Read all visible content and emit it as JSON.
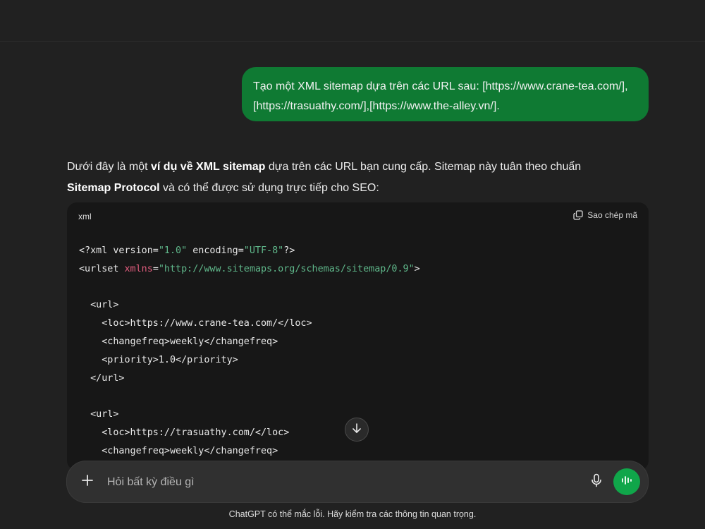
{
  "user_message": {
    "text": "Tạo một XML sitemap dựa trên các URL sau: [https://www.crane-tea.com/], [https://trasuathy.com/],[https://www.the-alley.vn/]."
  },
  "assistant_message": {
    "intro_part1": "Dưới đây là một ",
    "intro_bold1": "ví dụ về XML sitemap",
    "intro_part2": " dựa trên các URL bạn cung cấp. Sitemap này tuân theo chuẩn ",
    "intro_bold2": "Sitemap Protocol",
    "intro_part3": " và có thể được sử dụng trực tiếp cho SEO:"
  },
  "code_block": {
    "language": "xml",
    "copy_label": "Sao chép mã",
    "lines": [
      [
        {
          "t": "pi",
          "v": "<?xml version="
        },
        {
          "t": "str",
          "v": "\"1.0\""
        },
        {
          "t": "pi",
          "v": " encoding="
        },
        {
          "t": "str",
          "v": "\"UTF-8\""
        },
        {
          "t": "pi",
          "v": "?>"
        }
      ],
      [
        {
          "t": "tag",
          "v": "<urlset "
        },
        {
          "t": "attr",
          "v": "xmlns"
        },
        {
          "t": "tag",
          "v": "="
        },
        {
          "t": "str",
          "v": "\"http://www.sitemaps.org/schemas/sitemap/0.9\""
        },
        {
          "t": "tag",
          "v": ">"
        }
      ],
      [],
      [
        {
          "t": "tag",
          "v": "  <url>"
        }
      ],
      [
        {
          "t": "tag",
          "v": "    <loc>https://www.crane-tea.com/</loc>"
        }
      ],
      [
        {
          "t": "tag",
          "v": "    <changefreq>weekly</changefreq>"
        }
      ],
      [
        {
          "t": "tag",
          "v": "    <priority>1.0</priority>"
        }
      ],
      [
        {
          "t": "tag",
          "v": "  </url>"
        }
      ],
      [],
      [
        {
          "t": "tag",
          "v": "  <url>"
        }
      ],
      [
        {
          "t": "tag",
          "v": "    <loc>https://trasuathy.com/</loc>"
        }
      ],
      [
        {
          "t": "tag",
          "v": "    <changefreq>weekly</changefreq>"
        }
      ]
    ]
  },
  "composer": {
    "placeholder": "Hỏi bất kỳ điều gì"
  },
  "footer": {
    "disclaimer": "ChatGPT có thể mắc lỗi. Hãy kiểm tra các thông tin quan trọng."
  },
  "icons": {
    "copy": "copy-icon",
    "scroll_down": "arrow-down-icon",
    "plus": "plus-icon",
    "mic": "microphone-icon",
    "voice": "voice-waveform-icon"
  },
  "colors": {
    "background": "#212121",
    "user_bubble": "#0f7a33",
    "code_bg": "#171717",
    "string": "#5fb78a",
    "attribute": "#e05c7d",
    "voice_button": "#10a64a"
  }
}
